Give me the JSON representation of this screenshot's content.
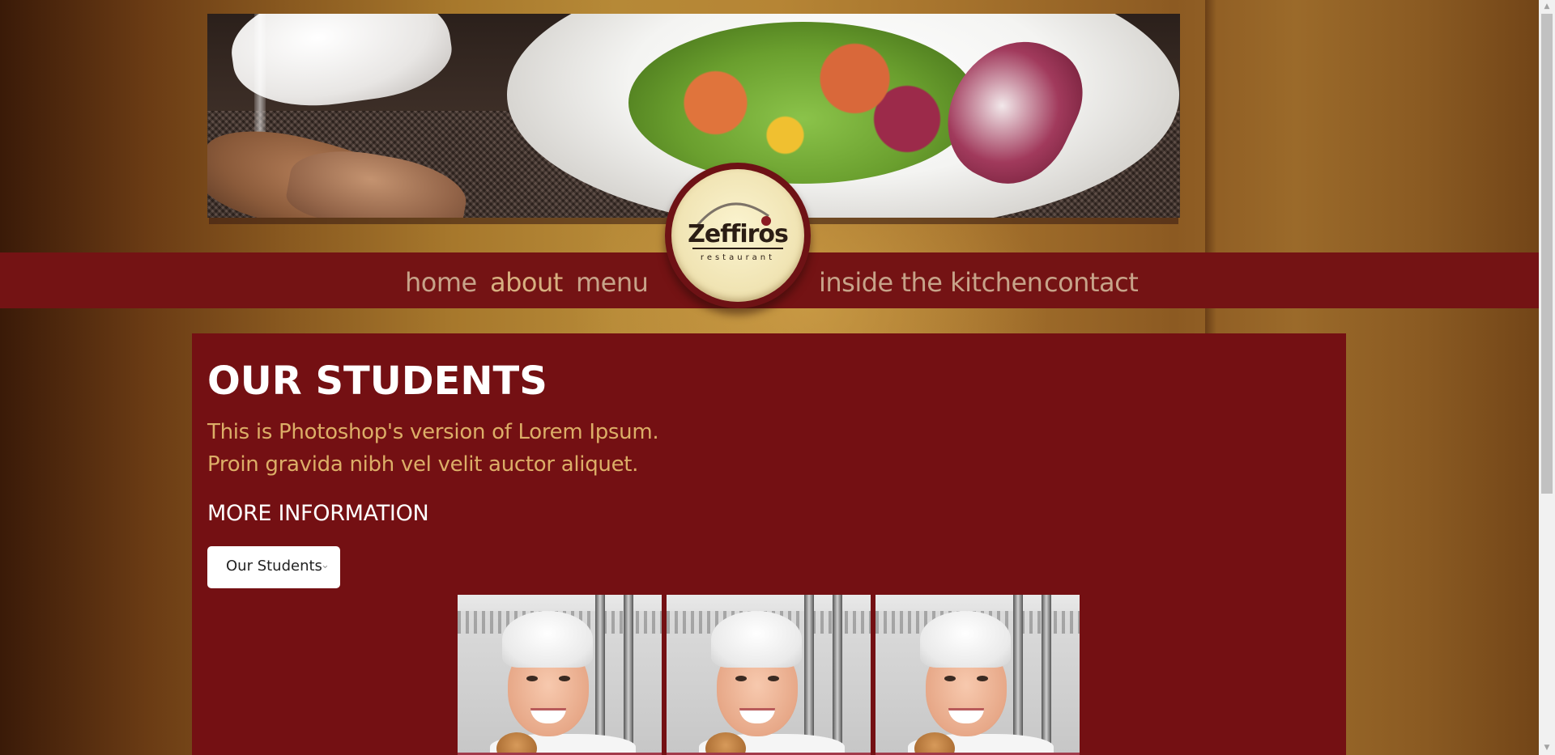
{
  "site": {
    "logo": {
      "name": "Zeffiros",
      "tagline": "restaurant"
    }
  },
  "nav": {
    "items": [
      {
        "label": "home"
      },
      {
        "label": "about"
      },
      {
        "label": "menu"
      },
      {
        "label": "inside the kitchen"
      },
      {
        "label": "contact"
      }
    ]
  },
  "main": {
    "title": "OUR STUDENTS",
    "intro_lines": [
      "This is Photoshop's version of Lorem Ipsum.",
      "Proin gravida nibh vel velit auctor aliquet."
    ],
    "more_heading": "MORE INFORMATION",
    "select": {
      "selected": "Our Students",
      "caret_icon": "chevron-down-icon"
    },
    "gallery_count": 3
  },
  "colors": {
    "nav_bg": "#741314",
    "content_bg": "#741013",
    "nav_link": "#c7a389",
    "intro_text": "#dcae67",
    "heading_text": "#ffffff"
  },
  "scrollbar": {
    "position_fraction": 0.0
  }
}
